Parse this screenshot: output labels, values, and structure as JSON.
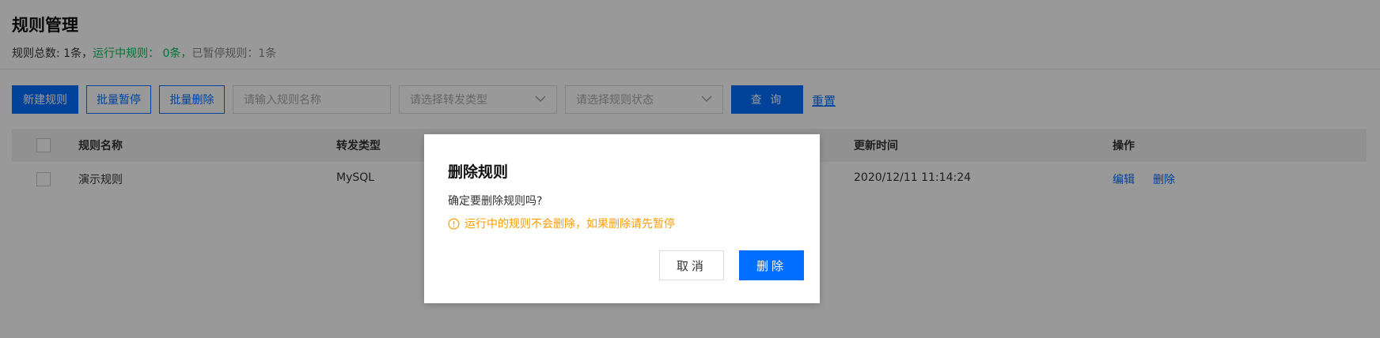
{
  "header": {
    "title": "规则管理",
    "stats": {
      "total": "规则总数: 1条，",
      "running": "运行中规则： 0条，",
      "paused": "已暂停规则：1条"
    }
  },
  "toolbar": {
    "new_label": "新建规则",
    "batch_pause_label": "批量暂停",
    "batch_delete_label": "批量删除",
    "search_placeholder": "请输入规则名称",
    "forward_type_placeholder": "请选择转发类型",
    "status_placeholder": "请选择规则状态",
    "query_label": "查 询",
    "reset_label": "重置"
  },
  "table": {
    "columns": [
      "规则名称",
      "转发类型",
      "更新时间",
      "操作"
    ],
    "rows": [
      {
        "name": "演示规则",
        "type": "MySQL",
        "updated": "2020/12/11 11:14:24",
        "edit": "编辑",
        "delete": "删除"
      }
    ]
  },
  "dialog": {
    "title": "删除规则",
    "message": "确定要删除规则吗?",
    "warning": "运行中的规则不会删除，如果删除请先暂停",
    "cancel_label": "取消",
    "confirm_label": "删除"
  },
  "colors": {
    "primary": "#006eff",
    "running_green": "#0abf5b",
    "warning_orange": "#ff9d00"
  }
}
